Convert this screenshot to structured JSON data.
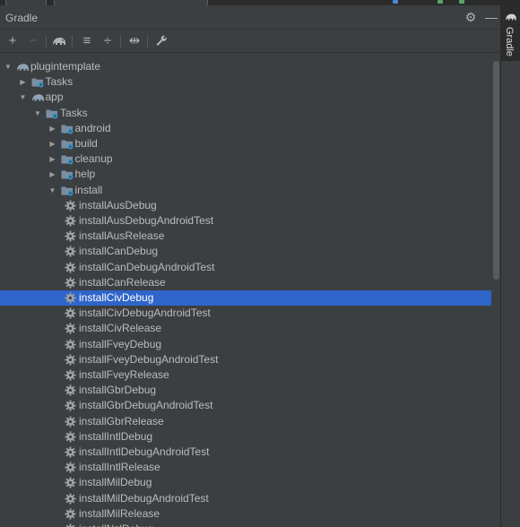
{
  "panel": {
    "title": "Gradle"
  },
  "sidebar": {
    "tab_label": "Gradle"
  },
  "toolbar": {
    "add": "+",
    "remove": "−",
    "expand_all": "≡",
    "collapse_all": "÷",
    "toggle_offline": "⇹",
    "settings": "🔧"
  },
  "header_buttons": {
    "settings": "⚙",
    "hide": "—"
  },
  "colors": {
    "background": "#3c3f41",
    "selection": "#2f65ca",
    "text": "#bbbbbb",
    "folder": "#7a8fa3",
    "gear_badge": "#3592c4"
  },
  "tree": {
    "root": "plugintemplate",
    "root_tasks": "Tasks",
    "app": "app",
    "app_tasks": "Tasks",
    "groups": [
      "android",
      "build",
      "cleanup",
      "help",
      "install"
    ],
    "install_tasks": [
      "installAusDebug",
      "installAusDebugAndroidTest",
      "installAusRelease",
      "installCanDebug",
      "installCanDebugAndroidTest",
      "installCanRelease",
      "installCivDebug",
      "installCivDebugAndroidTest",
      "installCivRelease",
      "installFveyDebug",
      "installFveyDebugAndroidTest",
      "installFveyRelease",
      "installGbrDebug",
      "installGbrDebugAndroidTest",
      "installGbrRelease",
      "installIntlDebug",
      "installIntlDebugAndroidTest",
      "installIntlRelease",
      "installMilDebug",
      "installMilDebugAndroidTest",
      "installMilRelease",
      "installNzlDebug"
    ],
    "selected_task": "installCivDebug"
  }
}
